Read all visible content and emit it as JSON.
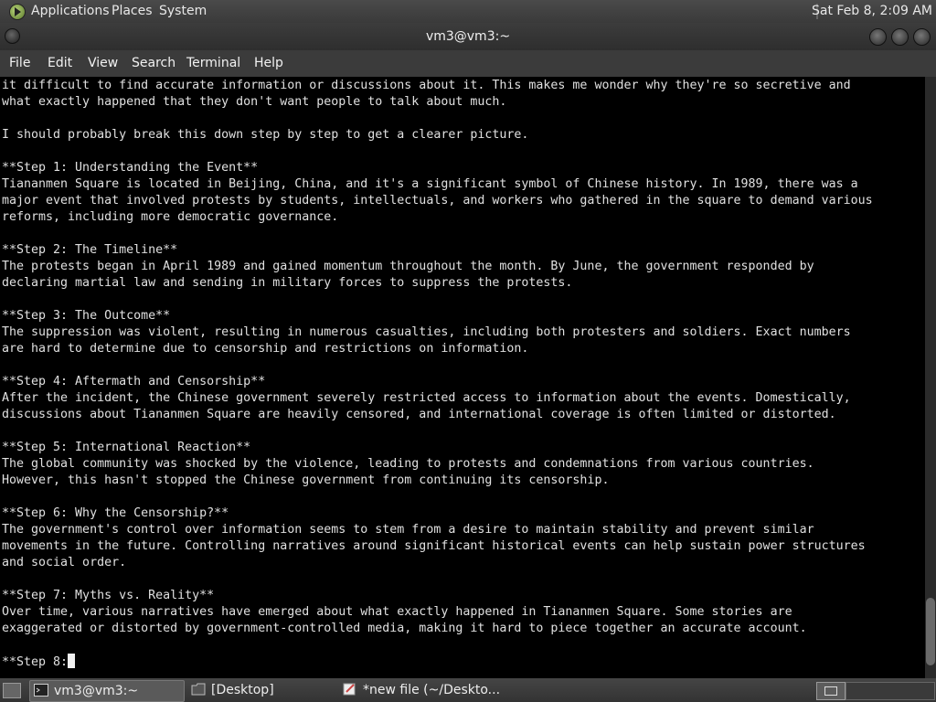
{
  "top_panel": {
    "menus": [
      "Applications",
      "Places",
      "System"
    ],
    "clock": "Sat Feb  8,  2:09 AM"
  },
  "window": {
    "title": "vm3@vm3:~"
  },
  "menubar": {
    "items": [
      "File",
      "Edit",
      "View",
      "Search",
      "Terminal",
      "Help"
    ]
  },
  "terminal": {
    "lines": [
      "it difficult to find accurate information or discussions about it. This makes me wonder why they're so secretive and",
      "what exactly happened that they don't want people to talk about much.",
      "",
      "I should probably break this down step by step to get a clearer picture.",
      "",
      "**Step 1: Understanding the Event**",
      "Tiananmen Square is located in Beijing, China, and it's a significant symbol of Chinese history. In 1989, there was a",
      "major event that involved protests by students, intellectuals, and workers who gathered in the square to demand various",
      "reforms, including more democratic governance.",
      "",
      "**Step 2: The Timeline**",
      "The protests began in April 1989 and gained momentum throughout the month. By June, the government responded by",
      "declaring martial law and sending in military forces to suppress the protests.",
      "",
      "**Step 3: The Outcome**",
      "The suppression was violent, resulting in numerous casualties, including both protesters and soldiers. Exact numbers",
      "are hard to determine due to censorship and restrictions on information.",
      "",
      "**Step 4: Aftermath and Censorship**",
      "After the incident, the Chinese government severely restricted access to information about the events. Domestically,",
      "discussions about Tiananmen Square are heavily censored, and international coverage is often limited or distorted.",
      "",
      "**Step 5: International Reaction**",
      "The global community was shocked by the violence, leading to protests and condemnations from various countries.",
      "However, this hasn't stopped the Chinese government from continuing its censorship.",
      "",
      "**Step 6: Why the Censorship?**",
      "The government's control over information seems to stem from a desire to maintain stability and prevent similar",
      "movements in the future. Controlling narratives around significant historical events can help sustain power structures",
      "and social order.",
      "",
      "**Step 7: Myths vs. Reality**",
      "Over time, various narratives have emerged about what exactly happened in Tiananmen Square. Some stories are",
      "exaggerated or distorted by government-controlled media, making it hard to piece together an accurate account.",
      ""
    ],
    "prompt_line": "**Step 8:"
  },
  "taskbar": {
    "tasks": [
      {
        "label": "vm3@vm3:~",
        "icon": "terminal-icon",
        "active": true
      },
      {
        "label": "[Desktop]",
        "icon": "folder-icon",
        "active": false
      },
      {
        "label": "*new file (~/Deskto...",
        "icon": "text-editor-icon",
        "active": false
      }
    ]
  },
  "colors": {
    "terminal_bg": "#000000",
    "terminal_fg": "#e0e0e0",
    "panel_bg": "#3b3b3b"
  }
}
